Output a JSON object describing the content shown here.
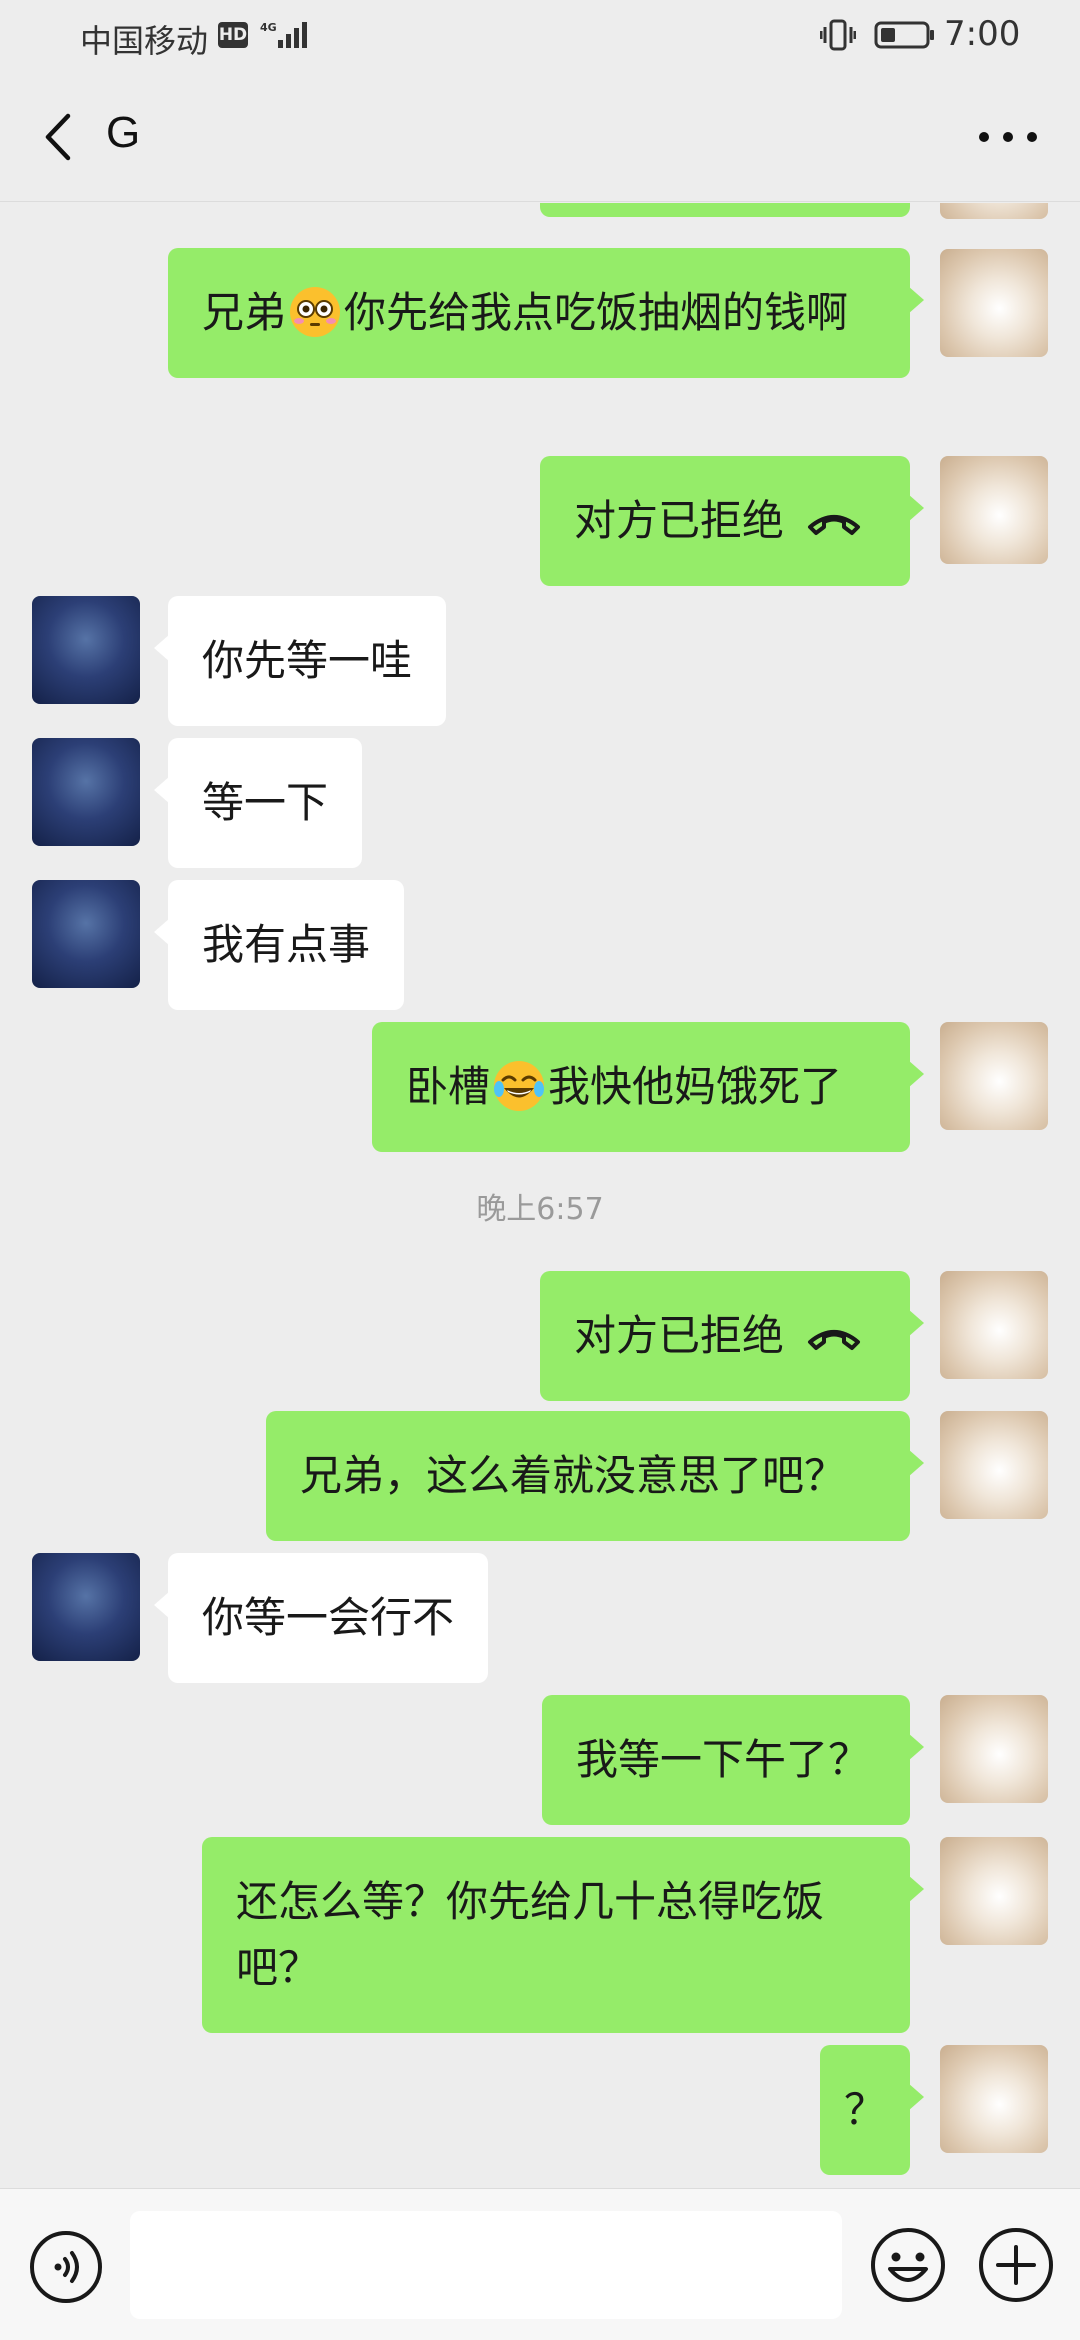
{
  "status_bar": {
    "carrier": "中国移动",
    "hd": "HD",
    "network": "4G",
    "time": "7:00"
  },
  "header": {
    "title": "G"
  },
  "messages": [
    {
      "text": "兄弟",
      "emoji": "flushed-face",
      "text2": "你先给我点吃饭抽烟的钱啊"
    },
    {
      "text": "对方已拒绝",
      "icon": "phone-hangup-icon"
    },
    {
      "text": "你先等一哇"
    },
    {
      "text": "等一下"
    },
    {
      "text": "我有点事"
    },
    {
      "text": "卧槽",
      "emoji": "tears-of-joy-face",
      "text2": "我快他妈饿死了"
    },
    {
      "text": "对方已拒绝",
      "icon": "phone-hangup-icon"
    },
    {
      "text": "兄弟，这么着就没意思了吧？"
    },
    {
      "text": "你等一会行不"
    },
    {
      "text": "我等一下午了？"
    },
    {
      "text": "还怎么等？你先给几十总得吃饭吧？"
    },
    {
      "text": "？"
    }
  ],
  "timestamp": "晚上6:57",
  "colors": {
    "outgoing_bubble": "#95ec69",
    "incoming_bubble": "#ffffff",
    "background": "#ededed"
  }
}
